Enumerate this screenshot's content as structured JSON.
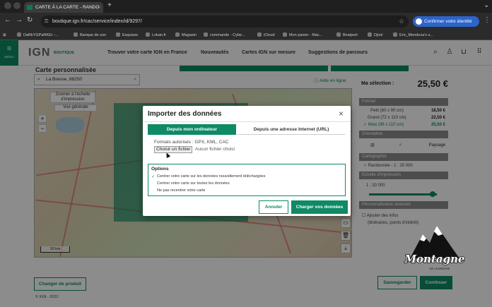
{
  "browser": {
    "tab_title": "CARTE À LA CARTE - RANDO",
    "url": "boutique.ign.fr/cac/service/index/id/9297/",
    "confirm_identity": "Confirmer votre identité",
    "bookmarks": [
      "DaRkYGPaRKEr -...",
      "Banque de son",
      "Esquisse",
      "Lokan.fr",
      "Magasin",
      "commande - Cybe...",
      "iCloud",
      "Mon panier - Mac...",
      "Beatport",
      "Djool",
      "Eric_Mendoza's s..."
    ]
  },
  "header": {
    "menu_label": "MENU",
    "logo": "IGN",
    "logo_sub": "BOUTIQUE",
    "nav": [
      "Trouver votre carte IGN en France",
      "Nouveautés",
      "Cartes IGN sur mesure",
      "Suggestions de parcours"
    ]
  },
  "page": {
    "title": "Carte personnalisée",
    "location_value": "La Bresse, 88250",
    "help": "Aide en ligne",
    "zoom_print": "Zoomer à l'échelle d'impression",
    "general_view": "Vue générale",
    "scale": "10 km",
    "change_product": "Changer de produit",
    "footer": "© IGN - 2022"
  },
  "panel": {
    "selection_label": "Ma sélection :",
    "selection_price": "25,50 €",
    "format_title": "Format",
    "formats": [
      {
        "label": "Petit (60 x 90 cm)",
        "price": "18,50 €"
      },
      {
        "label": "Grand (72 x 110 cm)",
        "price": "22,50 €"
      },
      {
        "label": "Maxi (96 x 110 cm)",
        "price": "25,50 €"
      }
    ],
    "orientation_title": "Orientation",
    "orientation_value": "Paysage",
    "cartography_title": "Cartographie",
    "cartography_value": "Randonnée - 1 : 25 000",
    "scale_title": "Echelle d'impression",
    "scale_value": "1 : 20 000",
    "custom_title": "Personnalisation avancée",
    "custom_option": "Ajouter des infos",
    "custom_option_sub": "(itinéraires, points d'intérêt)",
    "save": "Sauvegarder",
    "continue": "Continuer"
  },
  "dialog": {
    "title": "Importer des données",
    "tab_computer": "Depuis mon ordinateur",
    "tab_url": "Depuis une adresse Internet (URL)",
    "formats": "Formats autorisés : GPX, KML, CAC",
    "choose_file": "Choisir un fichier",
    "no_file": "Aucun fichier choisi",
    "options_title": "Options",
    "options": [
      "Centrer votre carte sur les données nouvellement téléchargées",
      "Centrer votre carte sur toutes les données",
      "Ne pas recentrer votre carte"
    ],
    "cancel": "Annuler",
    "submit": "Charger vos données"
  },
  "watermark": {
    "text": "Montagne",
    "subtext": "DE LA BRESSE"
  }
}
